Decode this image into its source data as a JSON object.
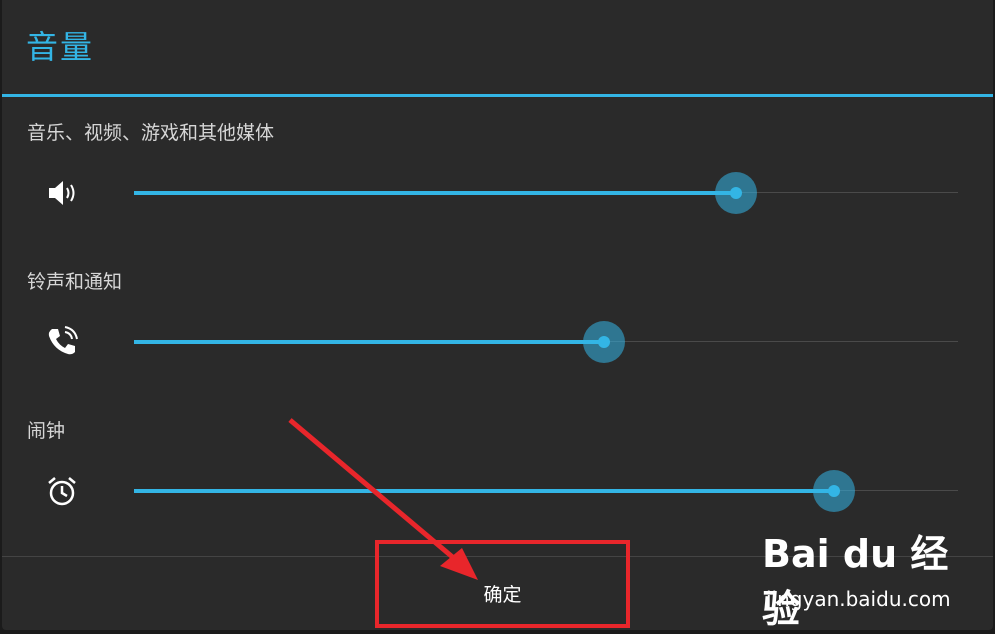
{
  "dialog": {
    "title": "音量",
    "ok_label": "确定"
  },
  "rows": [
    {
      "label": "音乐、视频、游戏和其他媒体",
      "icon": "speaker-icon",
      "level": 0.73
    },
    {
      "label": "铃声和通知",
      "icon": "phone-ring-icon",
      "level": 0.57
    },
    {
      "label": "闹钟",
      "icon": "alarm-clock-icon",
      "level": 0.85
    }
  ],
  "watermark": {
    "logo": "Bai du 经验",
    "url": "jingyan.baidu.com"
  },
  "colors": {
    "accent": "#33b5e5",
    "annotation": "#e8262b",
    "background": "#2a2a2a"
  }
}
